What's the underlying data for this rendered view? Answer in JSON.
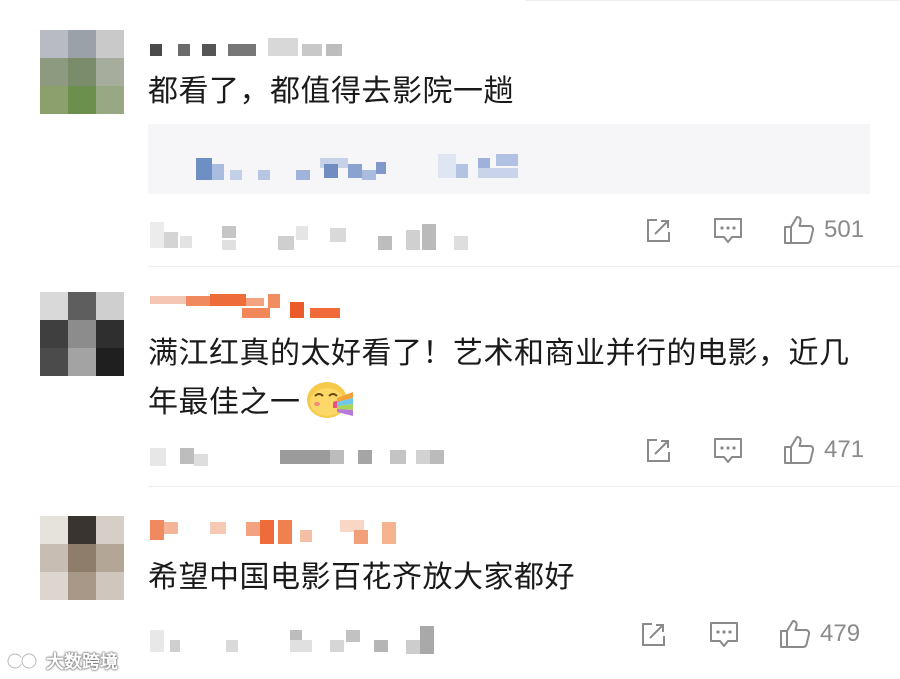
{
  "comments": [
    {
      "text": "都看了，都值得去影院一趟",
      "likes": "501"
    },
    {
      "text": "满江红真的太好看了！艺术和商业并行的电影，近几年最佳之一",
      "likes": "471"
    },
    {
      "text": "希望中国电影百花齐放大家都好",
      "likes": "479"
    }
  ],
  "watermark": "大数跨境",
  "icons": [
    "share-icon",
    "comment-icon",
    "like-icon",
    "emoji-icon",
    "watermark-logo-icon"
  ],
  "colors": {
    "text": "#1a1a1a",
    "icon": "#8a8a8a",
    "reply_bg": "#f6f6f8",
    "divider": "#eeeeee"
  }
}
